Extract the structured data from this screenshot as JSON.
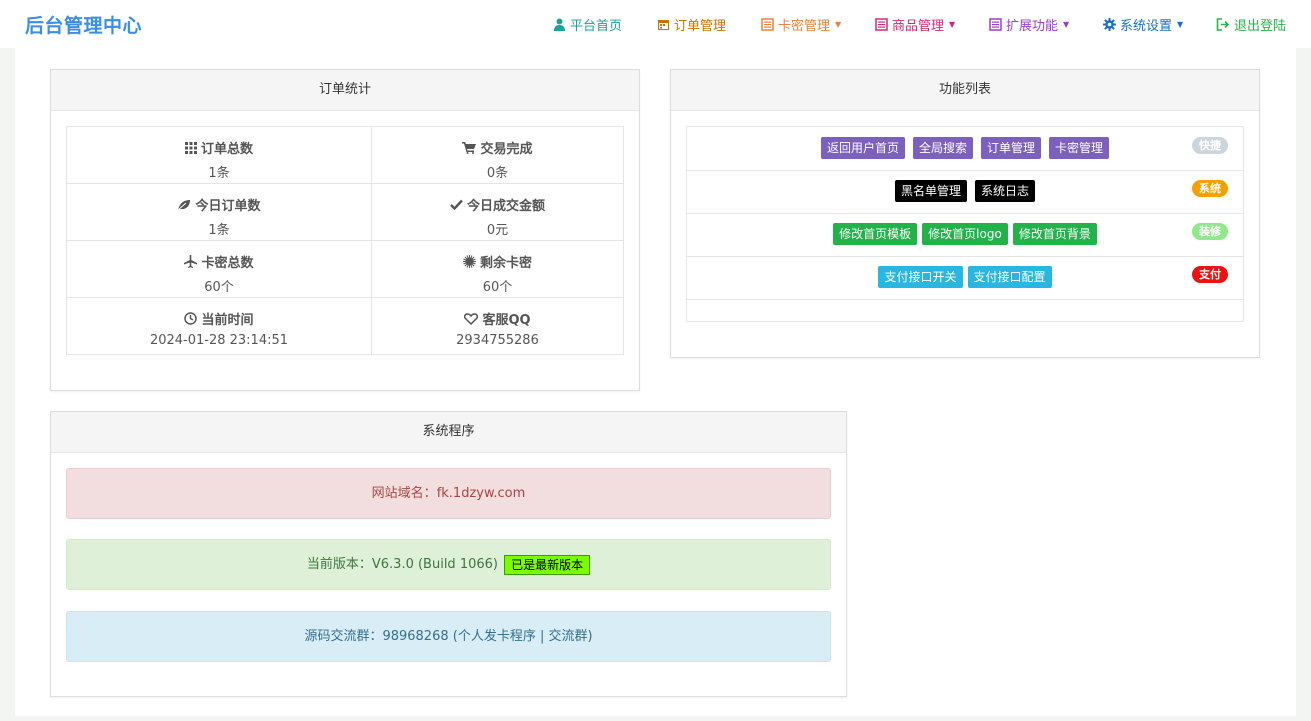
{
  "brand": "后台管理中心",
  "nav": [
    {
      "label": "平台首页",
      "color": "#1aa39a",
      "icon": "user-icon",
      "dropdown": false
    },
    {
      "label": "订单管理",
      "color": "#c67300",
      "icon": "calendar-icon",
      "dropdown": false
    },
    {
      "label": "卡密管理",
      "color": "#e8833a",
      "icon": "list-alt-icon",
      "dropdown": true
    },
    {
      "label": "商品管理",
      "color": "#d6267a",
      "icon": "list-alt-icon",
      "dropdown": true
    },
    {
      "label": "扩展功能",
      "color": "#9b3ec9",
      "icon": "list-alt-icon",
      "dropdown": true
    },
    {
      "label": "系统设置",
      "color": "#1a6fc9",
      "icon": "gear-icon",
      "dropdown": true
    },
    {
      "label": "退出登陆",
      "color": "#2bb24c",
      "icon": "logout-icon",
      "dropdown": false
    }
  ],
  "order_stats": {
    "title": "订单统计",
    "items": [
      {
        "label": "订单总数",
        "value": "1条",
        "icon": "grid-icon"
      },
      {
        "label": "交易完成",
        "value": "0条",
        "icon": "cart-icon"
      },
      {
        "label": "今日订单数",
        "value": "1条",
        "icon": "leaf-icon"
      },
      {
        "label": "今日成交金额",
        "value": "0元",
        "icon": "check-icon"
      },
      {
        "label": "卡密总数",
        "value": "60个",
        "icon": "plane-icon"
      },
      {
        "label": "剩余卡密",
        "value": "60个",
        "icon": "certificate-icon"
      },
      {
        "label": "当前时间",
        "value": "2024-01-28 23:14:51",
        "icon": "clock-icon"
      },
      {
        "label": "客服QQ",
        "value": "2934755286",
        "icon": "heart-icon"
      }
    ]
  },
  "functions": {
    "title": "功能列表",
    "rows": [
      {
        "buttons": [
          "返回用户首页",
          "全局搜索",
          "订单管理",
          "卡密管理"
        ],
        "btn_color": "#7d5fbe",
        "tag": "快捷",
        "tag_color": "#ccd5dd"
      },
      {
        "buttons": [
          "黑名单管理",
          "系统日志"
        ],
        "btn_color": "#000000",
        "tag": "系统",
        "tag_color": "#f5a000"
      },
      {
        "buttons": [
          "修改首页模板",
          "修改首页logo",
          "修改首页背景"
        ],
        "btn_color": "#21b34a",
        "tag": "装修",
        "tag_color": "#8fe88a"
      },
      {
        "buttons": [
          "支付接口开关",
          "支付接口配置"
        ],
        "btn_color": "#29b6e0",
        "tag": "支付",
        "tag_color": "#ee1111"
      }
    ]
  },
  "system": {
    "title": "系统程序",
    "domain_label": "网站域名：",
    "domain_value": "fk.1dzyw.com",
    "version_label": "当前版本：",
    "version_value": "V6.3.0 (Build 1066)",
    "latest_badge": "已是最新版本",
    "group_label": "源码交流群：",
    "group_value": "98968268",
    "group_note": "(个人发卡程序 | 交流群)"
  }
}
